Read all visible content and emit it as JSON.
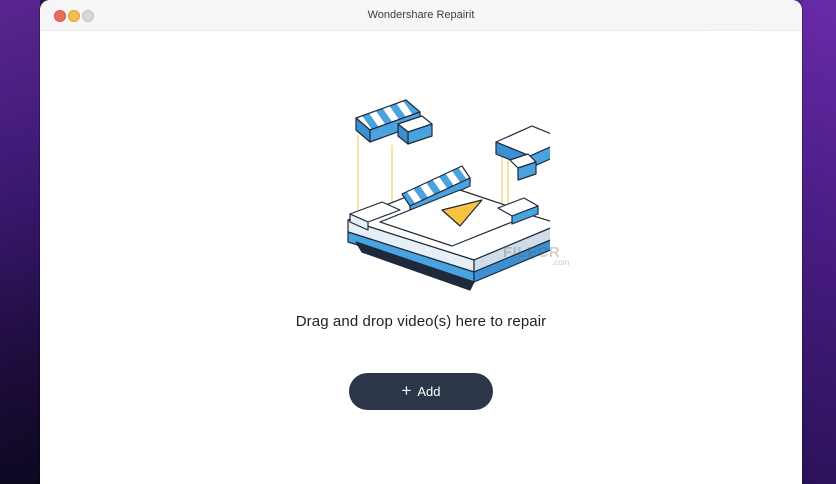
{
  "window": {
    "title": "Wondershare Repairit"
  },
  "main": {
    "drop_text": "Drag and drop video(s) here to repair",
    "add_label": "Add"
  },
  "watermark": {
    "text": "FILECR",
    "suffix": ".com"
  },
  "icons": {
    "add": "plus-icon",
    "illustration": "video-repair-illustration"
  },
  "colors": {
    "accent_blue": "#4aa3df",
    "play_yellow": "#f6c343",
    "button_bg": "#2b3649",
    "window_bg": "#ffffff"
  }
}
